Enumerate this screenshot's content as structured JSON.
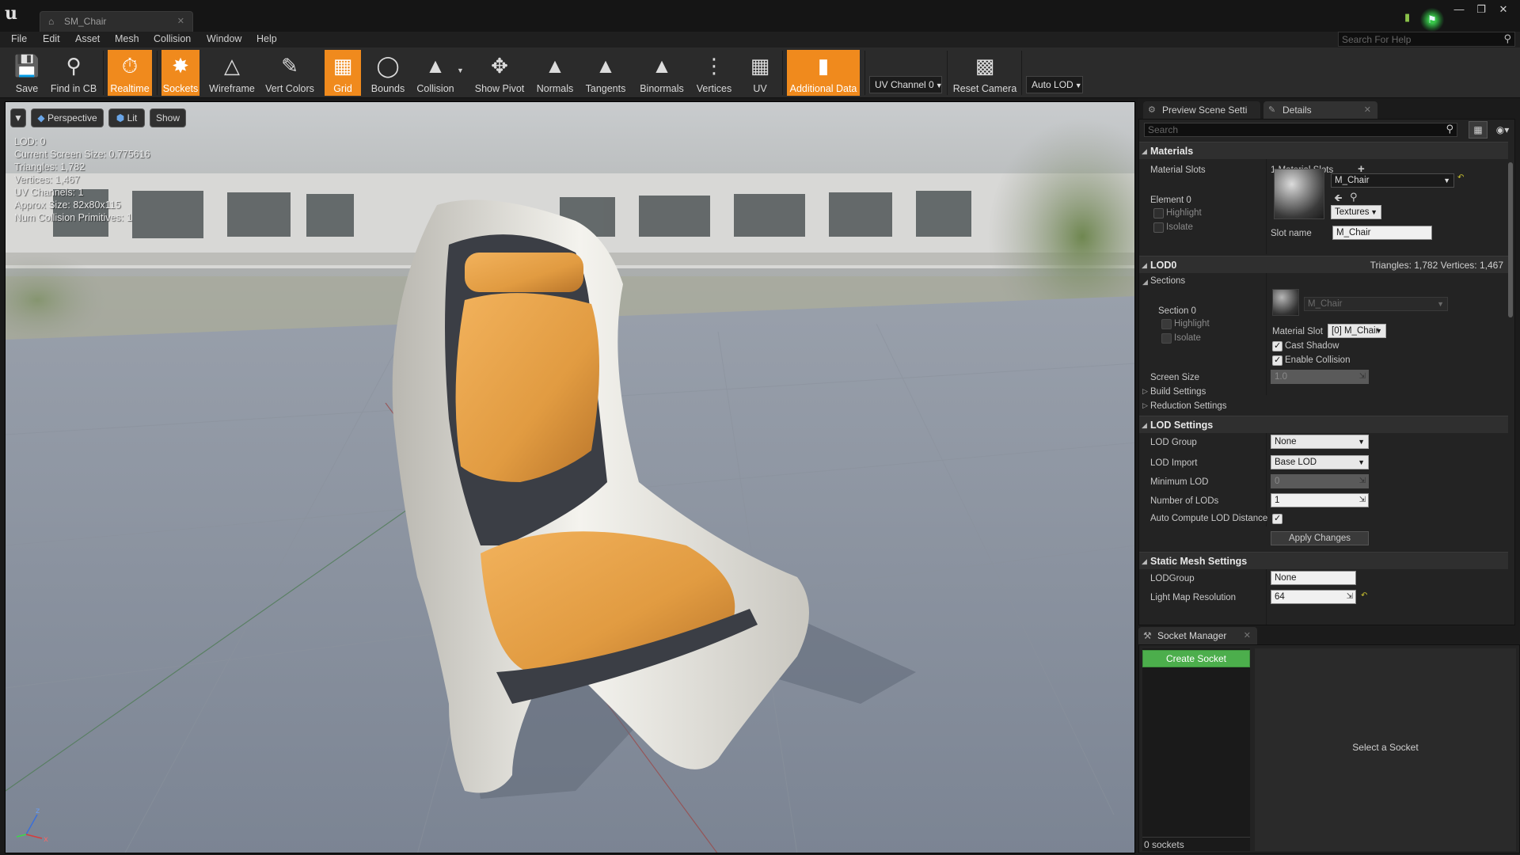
{
  "window": {
    "tab_title": "SM_Chair",
    "help_search_placeholder": "Search For Help"
  },
  "menu": [
    "File",
    "Edit",
    "Asset",
    "Mesh",
    "Collision",
    "Window",
    "Help"
  ],
  "toolbar": {
    "buttons": [
      {
        "label": "Save",
        "icon": "save-icon",
        "active": false
      },
      {
        "label": "Find in CB",
        "icon": "find-in-cb-icon",
        "active": false
      },
      {
        "label": "Realtime",
        "icon": "realtime-icon",
        "active": true
      },
      {
        "label": "Sockets",
        "icon": "sockets-icon",
        "active": true
      },
      {
        "label": "Wireframe",
        "icon": "wireframe-icon",
        "active": false
      },
      {
        "label": "Vert Colors",
        "icon": "vert-colors-icon",
        "active": false
      },
      {
        "label": "Grid",
        "icon": "grid-icon",
        "active": true
      },
      {
        "label": "Bounds",
        "icon": "bounds-icon",
        "active": false
      },
      {
        "label": "Collision",
        "icon": "collision-icon",
        "active": false
      },
      {
        "label": "Show Pivot",
        "icon": "show-pivot-icon",
        "active": false
      },
      {
        "label": "Normals",
        "icon": "normals-icon",
        "active": false
      },
      {
        "label": "Tangents",
        "icon": "tangents-icon",
        "active": false
      },
      {
        "label": "Binormals",
        "icon": "binormals-icon",
        "active": false
      },
      {
        "label": "Vertices",
        "icon": "vertices-icon",
        "active": false
      },
      {
        "label": "UV",
        "icon": "uv-icon",
        "active": false
      },
      {
        "label": "Additional Data",
        "icon": "additional-data-icon",
        "active": true
      },
      {
        "label": "Reset Camera",
        "icon": "reset-camera-icon",
        "active": false
      }
    ],
    "uv_channel": "UV Channel 0",
    "lod_select": "Auto LOD",
    "active_color": "#f08a1d"
  },
  "viewport": {
    "view_mode": "Perspective",
    "lit_mode": "Lit",
    "show_label": "Show",
    "stats": [
      "LOD:  0",
      "Current Screen Size:  0.775616",
      "Triangles:  1,782",
      "Vertices:  1,467",
      "UV Channels:  1",
      "Approx Size: 82x80x115",
      "Num Collision Primitives:  1"
    ]
  },
  "panels": {
    "tab_preview": "Preview Scene Setti",
    "tab_details": "Details",
    "search_placeholder": "Search"
  },
  "materials": {
    "header": "Materials",
    "slots_label": "Material Slots",
    "slots_value": "1 Material Slots",
    "element_label": "Element 0",
    "highlight": "Highlight",
    "isolate": "Isolate",
    "material": "M_Chair",
    "textures_label": "Textures",
    "slot_name_label": "Slot name",
    "slot_name_value": "M_Chair"
  },
  "lod0": {
    "header": "LOD0",
    "stats": "Triangles: 1,782   Vertices: 1,467",
    "sections_label": "Sections",
    "section_label": "Section 0",
    "highlight": "Highlight",
    "isolate": "Isolate",
    "material": "M_Chair",
    "material_slot_label": "Material Slot",
    "material_slot_value": "[0] M_Chair",
    "cast_shadow": "Cast Shadow",
    "enable_collision": "Enable Collision",
    "screen_size_label": "Screen Size",
    "screen_size_value": "1.0",
    "build_settings": "Build Settings",
    "reduction_settings": "Reduction Settings"
  },
  "lod_settings": {
    "header": "LOD Settings",
    "lod_group_label": "LOD Group",
    "lod_group_value": "None",
    "lod_import_label": "LOD Import",
    "lod_import_value": "Base LOD",
    "min_lod_label": "Minimum LOD",
    "min_lod_value": "0",
    "num_lods_label": "Number of LODs",
    "num_lods_value": "1",
    "auto_compute_label": "Auto Compute LOD Distance",
    "auto_compute_checked": true,
    "apply_changes": "Apply Changes"
  },
  "static_mesh_settings": {
    "header": "Static Mesh Settings",
    "lodgroup_label": "LODGroup",
    "lodgroup_value": "None",
    "lightmap_label": "Light Map Resolution",
    "lightmap_value": "64"
  },
  "socket_manager": {
    "tab": "Socket Manager",
    "create_button": "Create Socket",
    "count": "0 sockets",
    "placeholder": "Select a Socket"
  }
}
